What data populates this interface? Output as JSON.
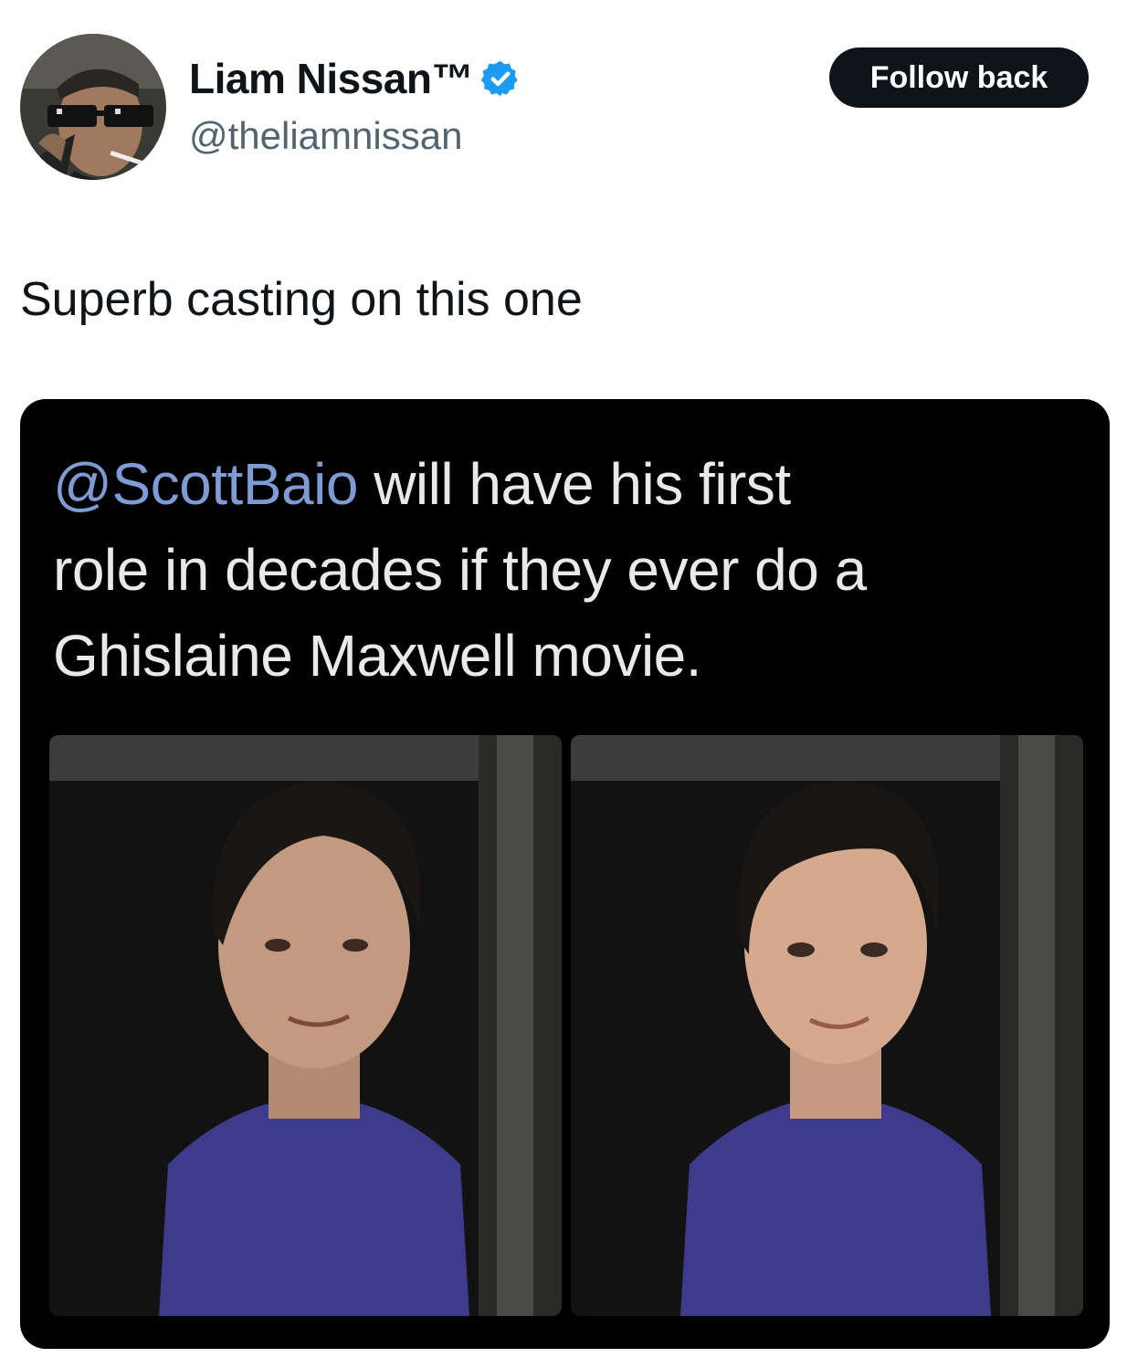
{
  "author": {
    "display_name": "Liam Nissan™",
    "handle": "@theliamnissan",
    "verified": true,
    "avatar_icon": "profile-photo"
  },
  "follow_button": {
    "label": "Follow back"
  },
  "tweet": {
    "text": "Superb casting on this one"
  },
  "media": {
    "caption_mention": "@ScottBaio",
    "caption_rest_line1": " will have his first",
    "caption_line2": "role in decades if they ever do a",
    "caption_line3": "Ghislaine Maxwell movie."
  },
  "colors": {
    "follow_button_bg": "#0f1419",
    "verified_badge": "#1d9bf0",
    "handle": "#536471",
    "mention": "#7f9bd6",
    "shirt": "#3e3a8c"
  }
}
